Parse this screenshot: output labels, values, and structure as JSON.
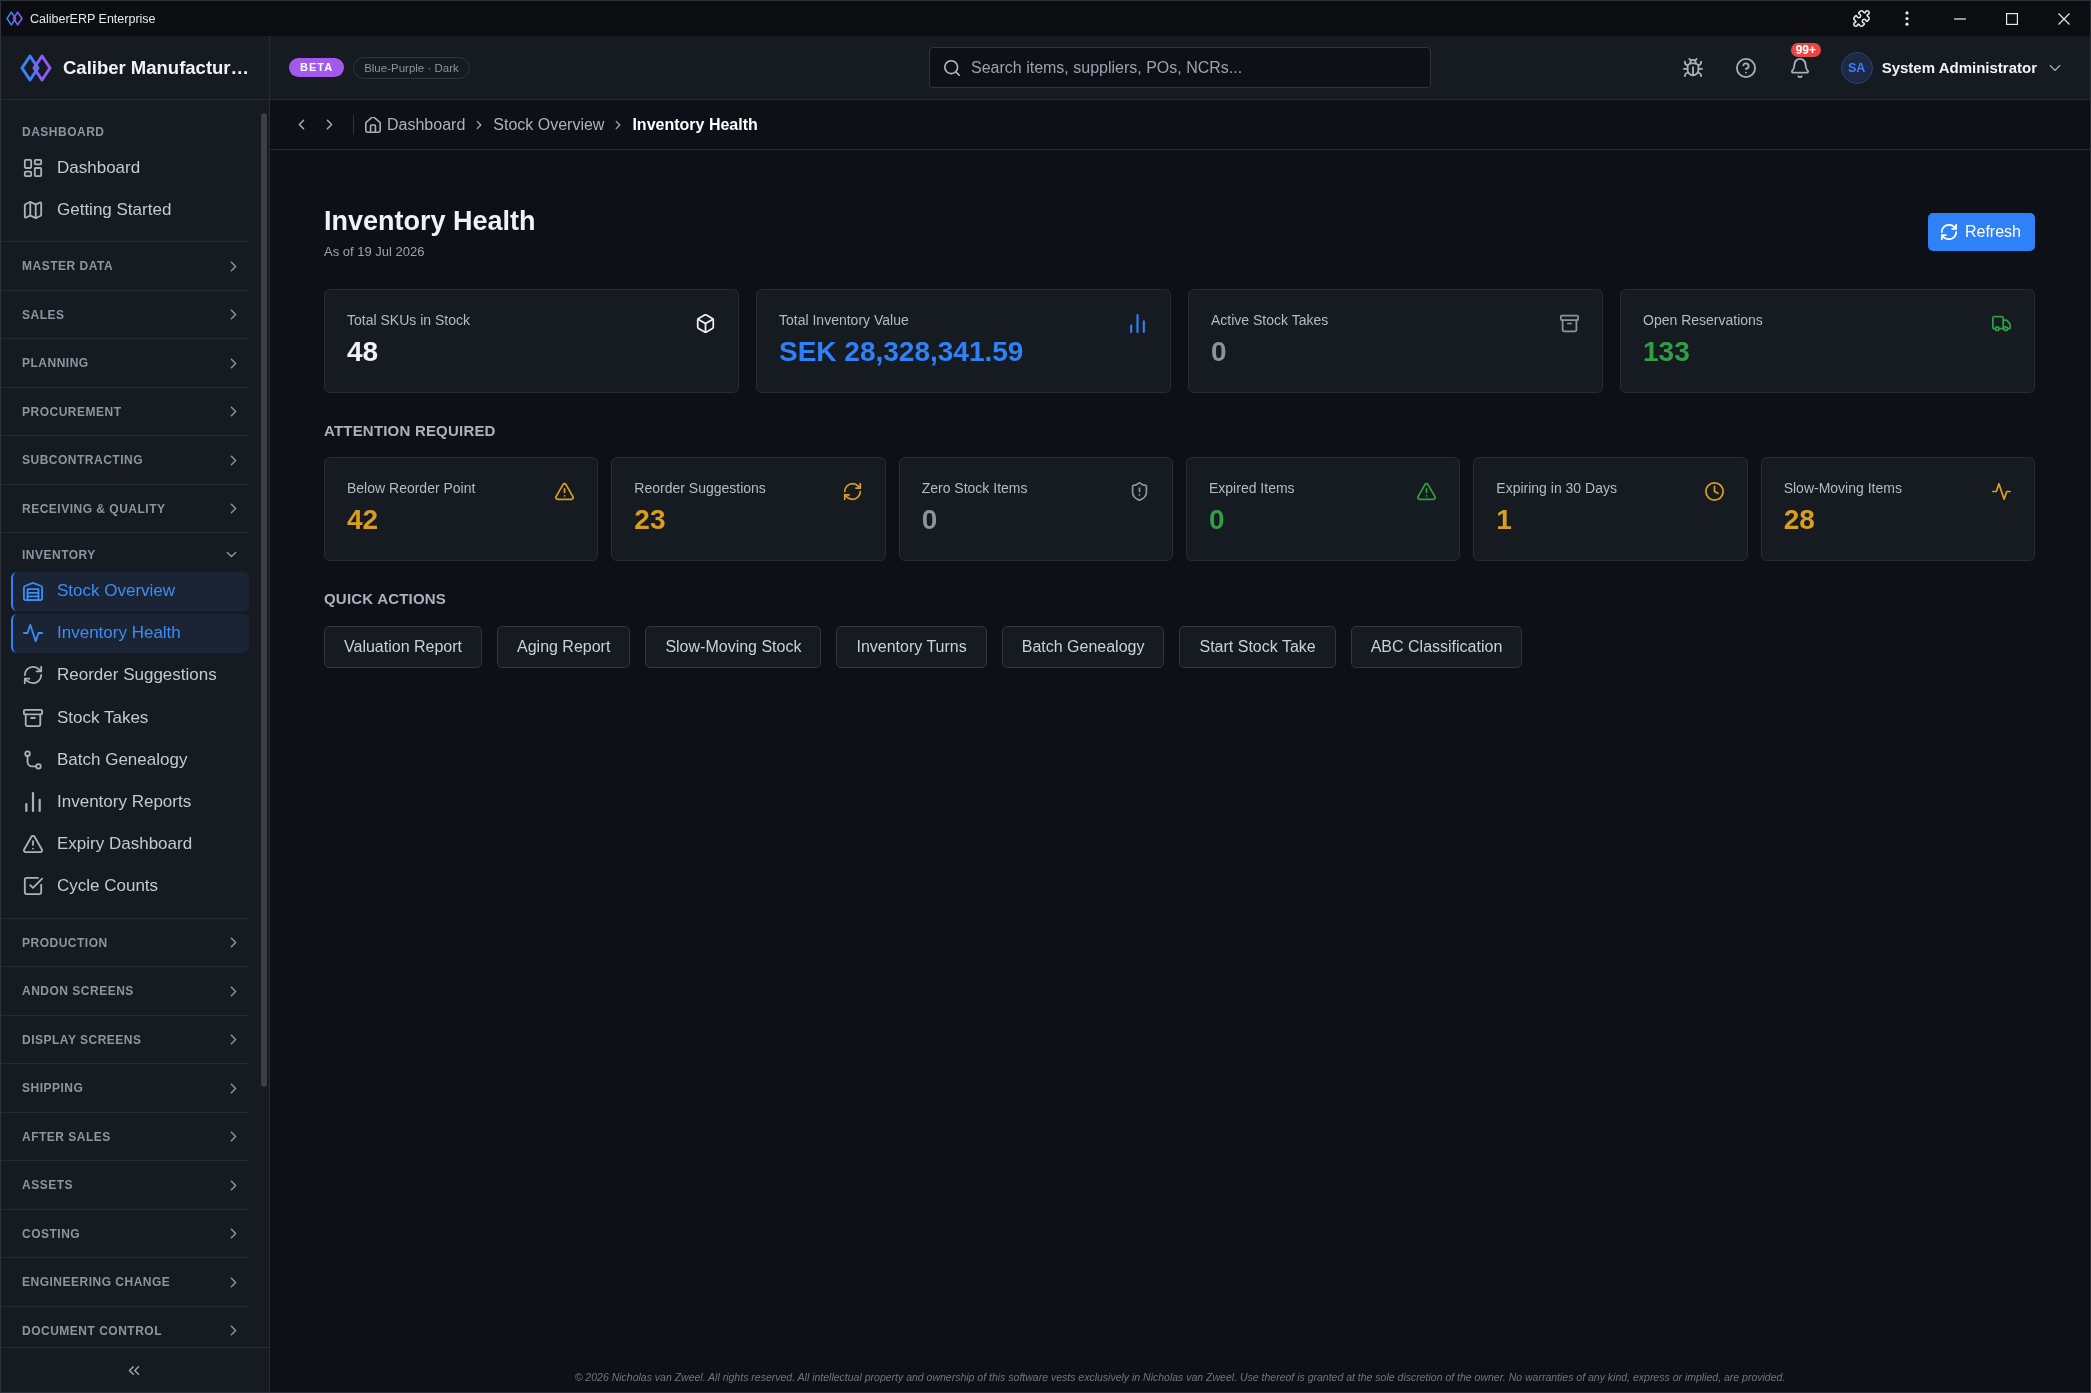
{
  "title_bar": {
    "title": "CaliberERP Enterprise"
  },
  "header": {
    "brand": "Caliber Manufactur…",
    "badge": "BETA",
    "theme": "Blue-Purple · Dark",
    "search": {
      "placeholder": "Search items, suppliers, POs, NCRs..."
    },
    "notifications": "99+",
    "user": {
      "initials": "SA",
      "name": "System Administrator"
    }
  },
  "sidebar": {
    "groups": [
      {
        "label": "DASHBOARD",
        "kind": "section",
        "expanded": true,
        "children": [
          {
            "label": "Dashboard",
            "selected": false
          },
          {
            "label": "Getting Started",
            "selected": false
          }
        ]
      },
      {
        "label": "MASTER DATA",
        "kind": "group",
        "expanded": false
      },
      {
        "label": "SALES",
        "kind": "group",
        "expanded": false
      },
      {
        "label": "PLANNING",
        "kind": "group",
        "expanded": false
      },
      {
        "label": "PROCUREMENT",
        "kind": "group",
        "expanded": false
      },
      {
        "label": "SUBCONTRACTING",
        "kind": "group",
        "expanded": false
      },
      {
        "label": "RECEIVING & QUALITY",
        "kind": "group",
        "expanded": false
      },
      {
        "label": "INVENTORY",
        "kind": "group",
        "expanded": true,
        "children": [
          {
            "label": "Stock Overview",
            "selected": true
          },
          {
            "label": "Inventory Health",
            "selected": true
          },
          {
            "label": "Reorder Suggestions",
            "selected": false
          },
          {
            "label": "Stock Takes",
            "selected": false
          },
          {
            "label": "Batch Genealogy",
            "selected": false
          },
          {
            "label": "Inventory Reports",
            "selected": false
          },
          {
            "label": "Expiry Dashboard",
            "selected": false
          },
          {
            "label": "Cycle Counts",
            "selected": false
          }
        ]
      },
      {
        "label": "PRODUCTION",
        "kind": "group",
        "expanded": false
      },
      {
        "label": "ANDON SCREENS",
        "kind": "group",
        "expanded": false
      },
      {
        "label": "DISPLAY SCREENS",
        "kind": "group",
        "expanded": false
      },
      {
        "label": "SHIPPING",
        "kind": "group",
        "expanded": false
      },
      {
        "label": "AFTER SALES",
        "kind": "group",
        "expanded": false
      },
      {
        "label": "ASSETS",
        "kind": "group",
        "expanded": false
      },
      {
        "label": "COSTING",
        "kind": "group",
        "expanded": false
      },
      {
        "label": "ENGINEERING CHANGE",
        "kind": "group",
        "expanded": false
      },
      {
        "label": "DOCUMENT CONTROL",
        "kind": "group",
        "expanded": false
      }
    ]
  },
  "breadcrumb": [
    {
      "label": "Dashboard",
      "current": false
    },
    {
      "label": "Stock Overview",
      "current": false
    },
    {
      "label": "Inventory Health",
      "current": true
    }
  ],
  "page": {
    "title": "Inventory Health",
    "subtitle": "As of 19 Jul 2026",
    "refresh_label": "Refresh"
  },
  "kpis": [
    {
      "label": "Total SKUs in Stock",
      "value": "48",
      "color": "#f0f3f6"
    },
    {
      "label": "Total Inventory Value",
      "value": "SEK 28,328,341.59",
      "color": "#2f81f7"
    },
    {
      "label": "Active Stock Takes",
      "value": "0",
      "color": "#8b949e"
    },
    {
      "label": "Open Reservations",
      "value": "133",
      "color": "#2ea043"
    }
  ],
  "attention": {
    "title": "ATTENTION REQUIRED",
    "cards": [
      {
        "label": "Below Reorder Point",
        "value": "42",
        "color": "#d99e1f"
      },
      {
        "label": "Reorder Suggestions",
        "value": "23",
        "color": "#d99e1f"
      },
      {
        "label": "Zero Stock Items",
        "value": "0",
        "color": "#8b949e"
      },
      {
        "label": "Expired Items",
        "value": "0",
        "color": "#2ea043"
      },
      {
        "label": "Expiring in 30 Days",
        "value": "1",
        "color": "#d99e1f"
      },
      {
        "label": "Slow-Moving Items",
        "value": "28",
        "color": "#d99e1f"
      }
    ]
  },
  "quick_actions": {
    "title": "QUICK ACTIONS",
    "buttons": [
      "Valuation Report",
      "Aging Report",
      "Slow-Moving Stock",
      "Inventory Turns",
      "Batch Genealogy",
      "Start Stock Take",
      "ABC Classification"
    ]
  },
  "footer": "© 2026 Nicholas van Zweel. All rights reserved. All intellectual property and ownership of this software vests exclusively in Nicholas van Zweel. Use thereof is granted at the sole discretion of the owner. No warranties of any kind, express or implied, are provided."
}
